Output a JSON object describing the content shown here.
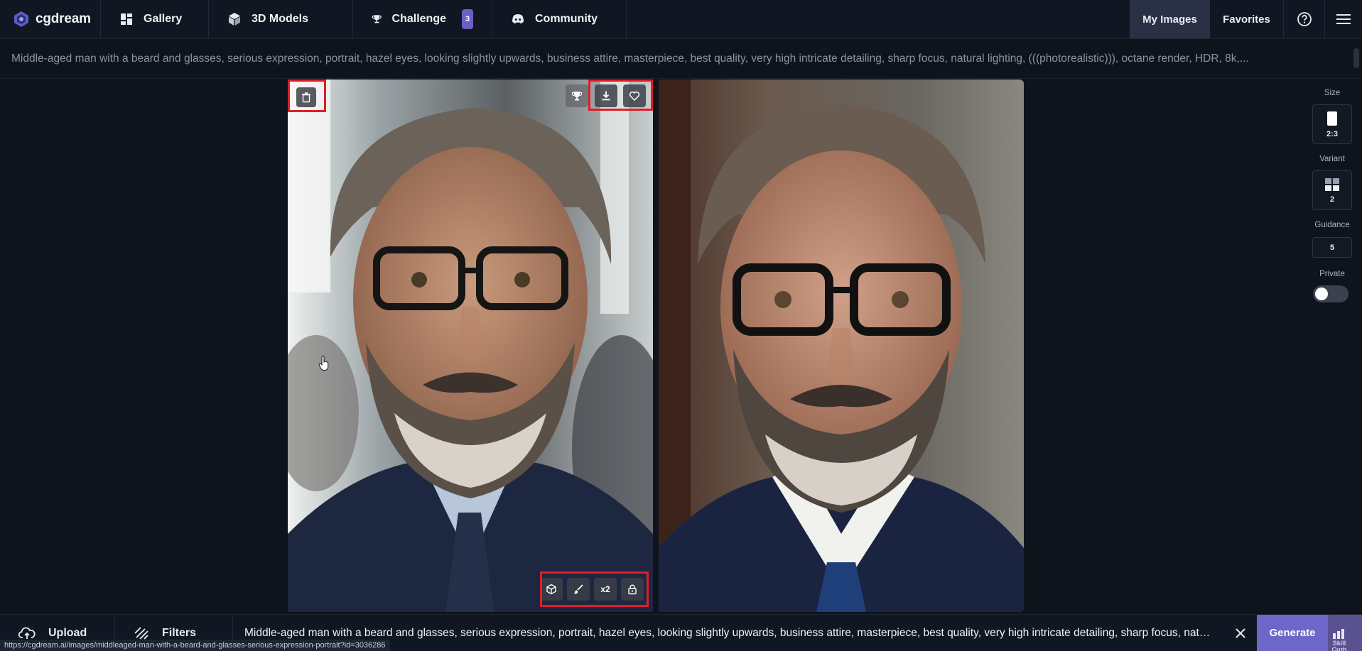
{
  "brand": {
    "name": "cgdream"
  },
  "nav": {
    "gallery": "Gallery",
    "models": "3D Models",
    "challenge": "Challenge",
    "challenge_badge": "3",
    "community": "Community",
    "my_images": "My Images",
    "favorites": "Favorites"
  },
  "prompt": {
    "text": "Middle-aged man with a beard and glasses, serious expression, portrait, hazel eyes, looking slightly upwards, business attire, masterpiece, best quality, very high intricate detailing, sharp focus, natural lighting, (((photorealistic))), octane render, HDR, 8k,..."
  },
  "images": {
    "upscale_label": "x2"
  },
  "settings": {
    "size_label": "Size",
    "size_value": "2:3",
    "variant_label": "Variant",
    "variant_value": "2",
    "guidance_label": "Guidance",
    "guidance_value": "5",
    "private_label": "Private"
  },
  "bottom": {
    "upload": "Upload",
    "filters": "Filters",
    "prompt": "Middle-aged man with a beard and glasses, serious expression, portrait, hazel eyes, looking slightly upwards, business attire, masterpiece, best quality, very high intricate detailing, sharp focus, natural ...",
    "generate": "Generate",
    "watermark": "Skill Curb"
  },
  "status_url": "https://cgdream.ai/images/middleaged-man-with-a-beard-and-glasses-serious-expression-portrait?id=3036286",
  "colors": {
    "accent": "#6f66c9",
    "highlight": "#e11d2a",
    "background": "#0f141c"
  }
}
